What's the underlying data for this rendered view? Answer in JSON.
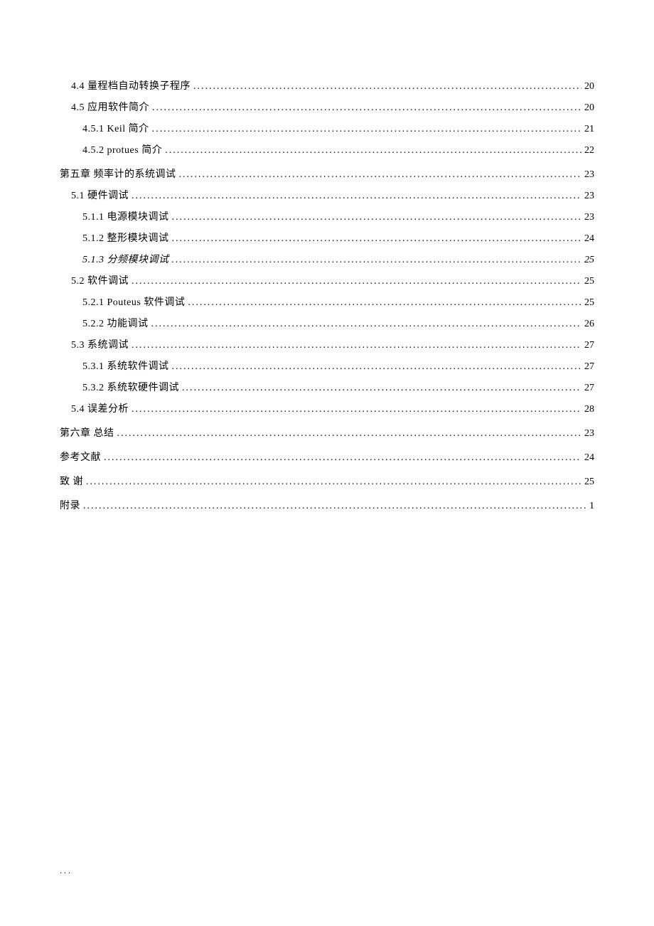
{
  "toc": [
    {
      "level": 1,
      "label": "4.4 量程档自动转换子程序",
      "page": "20",
      "spaced": false,
      "italic": false,
      "chapter": false
    },
    {
      "level": 1,
      "label": "4.5 应用软件简介",
      "page": "20",
      "spaced": false,
      "italic": false,
      "chapter": false
    },
    {
      "level": 2,
      "label": "4.5.1 Keil 简介",
      "page": "21",
      "spaced": false,
      "italic": false,
      "chapter": false
    },
    {
      "level": 2,
      "label": "4.5.2 protues 简介",
      "page": "22",
      "spaced": false,
      "italic": false,
      "chapter": false
    },
    {
      "level": 0,
      "label": "第五章 频率计的系统调试",
      "page": "23",
      "spaced": false,
      "italic": false,
      "chapter": true
    },
    {
      "level": 1,
      "label": "5.1 硬件调试",
      "page": "23",
      "spaced": false,
      "italic": false,
      "chapter": false
    },
    {
      "level": 2,
      "label": "5.1.1 电源模块调试",
      "page": "23",
      "spaced": false,
      "italic": false,
      "chapter": false
    },
    {
      "level": 2,
      "label": "5.1.2 整形模块调试",
      "page": "24",
      "spaced": false,
      "italic": false,
      "chapter": false
    },
    {
      "level": 2,
      "label": "5.1.3 分频模块调试",
      "page": "25",
      "spaced": false,
      "italic": true,
      "chapter": false
    },
    {
      "level": 1,
      "label": "5.2 软件调试",
      "page": "25",
      "spaced": false,
      "italic": false,
      "chapter": false
    },
    {
      "level": 2,
      "label": "5.2.1 Pouteus 软件调试",
      "page": "25",
      "spaced": false,
      "italic": false,
      "chapter": false
    },
    {
      "level": 2,
      "label": "5.2.2 功能调试",
      "page": "26",
      "spaced": false,
      "italic": false,
      "chapter": false
    },
    {
      "level": 1,
      "label": "5.3 系统调试",
      "page": "27",
      "spaced": false,
      "italic": false,
      "chapter": false
    },
    {
      "level": 2,
      "label": "5.3.1 系统软件调试",
      "page": "27",
      "spaced": false,
      "italic": false,
      "chapter": false
    },
    {
      "level": 2,
      "label": "5.3.2 系统软硬件调试",
      "page": "27",
      "spaced": false,
      "italic": false,
      "chapter": false
    },
    {
      "level": 1,
      "label": "5.4 误差分析",
      "page": "28",
      "spaced": false,
      "italic": false,
      "chapter": false
    },
    {
      "level": 0,
      "label": "第六章 总结",
      "page": "23",
      "spaced": false,
      "italic": false,
      "chapter": true
    },
    {
      "level": 0,
      "label": "参考文献",
      "page": "24",
      "spaced": false,
      "italic": false,
      "chapter": true
    },
    {
      "level": 0,
      "label": "致 谢",
      "page": "25",
      "spaced": false,
      "italic": false,
      "chapter": true
    },
    {
      "level": 0,
      "label": "附录",
      "page": "1",
      "spaced": false,
      "italic": false,
      "chapter": true
    }
  ],
  "footer": ".         .                ."
}
